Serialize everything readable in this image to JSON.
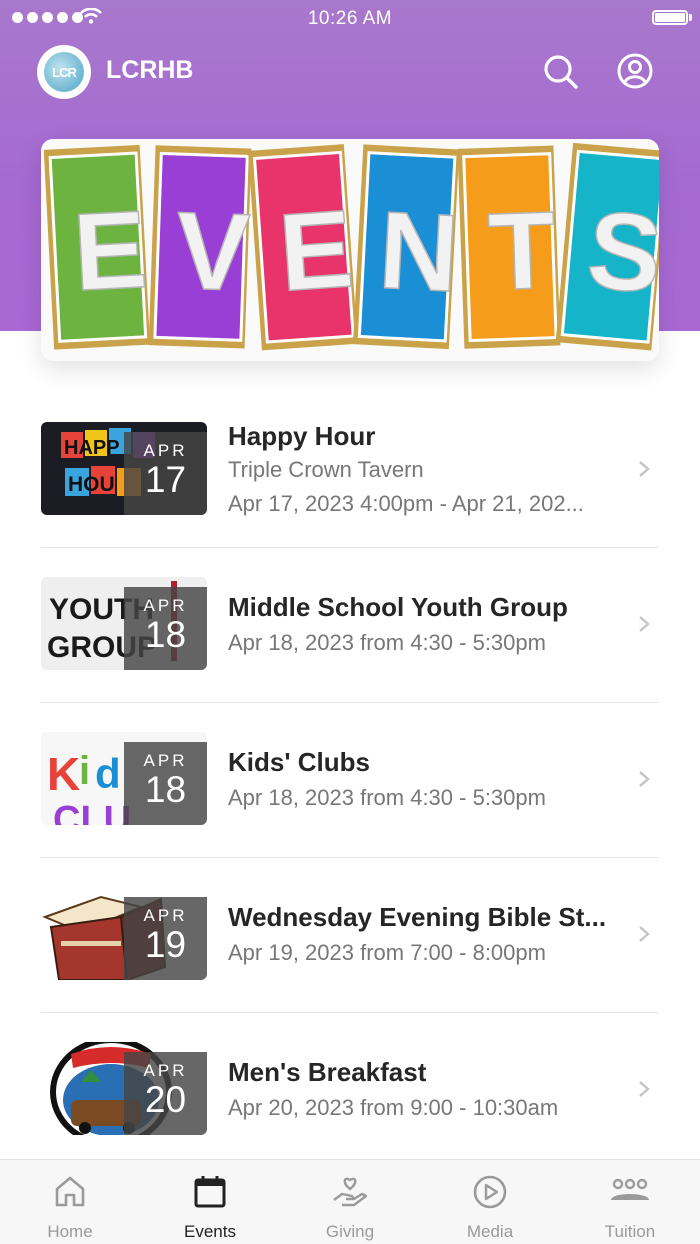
{
  "status_bar": {
    "time": "10:26 AM"
  },
  "app": {
    "title": "LCRHB",
    "logo_text": "LCR"
  },
  "banner": {
    "letters": [
      "E",
      "V",
      "E",
      "N",
      "T",
      "S"
    ],
    "colors": [
      "#6cb33f",
      "#9a3fd6",
      "#e8336b",
      "#1b8fd6",
      "#f59c1a",
      "#16b4c9"
    ]
  },
  "events": [
    {
      "title": "Happy Hour",
      "location": "Triple Crown Tavern",
      "when": "Apr 17, 2023 4:00pm - Apr 21, 202...",
      "month": "APR",
      "day": "17",
      "thumb": "happy-hour"
    },
    {
      "title": "Middle School Youth Group",
      "when": "Apr 18, 2023 from 4:30 - 5:30pm",
      "month": "APR",
      "day": "18",
      "thumb": "youth-group"
    },
    {
      "title": "Kids' Clubs",
      "when": "Apr 18, 2023 from 4:30 - 5:30pm",
      "month": "APR",
      "day": "18",
      "thumb": "kids-club"
    },
    {
      "title": "Wednesday Evening Bible St...",
      "when": "Apr 19, 2023 from 7:00 - 8:00pm",
      "month": "APR",
      "day": "19",
      "thumb": "bible"
    },
    {
      "title": "Men's Breakfast",
      "when": "Apr 20, 2023 from 9:00 - 10:30am",
      "month": "APR",
      "day": "20",
      "thumb": "woodys-diner"
    }
  ],
  "tabs": [
    {
      "label": "Home",
      "icon": "home-icon",
      "active": false
    },
    {
      "label": "Events",
      "icon": "calendar-icon",
      "active": true
    },
    {
      "label": "Giving",
      "icon": "giving-hand-icon",
      "active": false
    },
    {
      "label": "Media",
      "icon": "play-circle-icon",
      "active": false
    },
    {
      "label": "Tuition",
      "icon": "group-icon",
      "active": false
    }
  ],
  "colors": {
    "header": "#a56ad2",
    "tab_active": "#222222",
    "tab_inactive": "#9a9a9a"
  }
}
